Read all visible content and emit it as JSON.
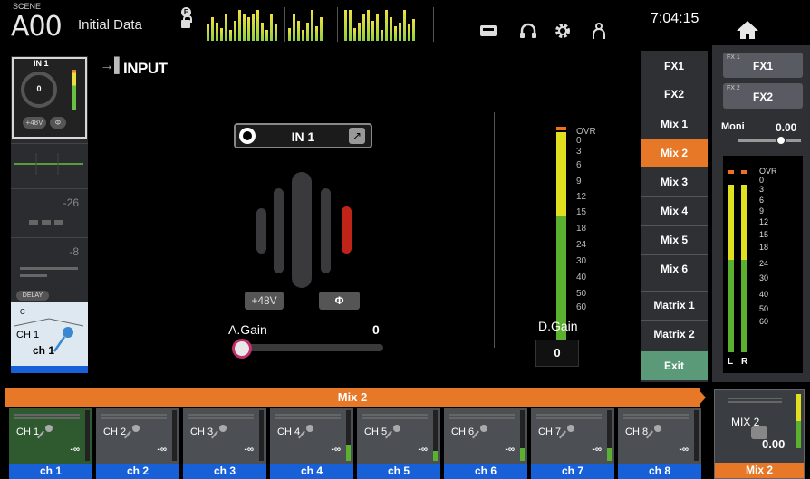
{
  "scene": {
    "label": "SCENE",
    "number": "A00",
    "title": "Initial Data"
  },
  "lock_badge": "E",
  "clock": "7:04:15",
  "colors": {
    "accent": "#e67828",
    "channel_blue": "#1860d8",
    "exit_green": "#5a9a78"
  },
  "strip": {
    "input_label": "IN 1",
    "gain_value": "0",
    "phantom_label": "+48V",
    "phase_label": "Φ",
    "gate_value": "-26",
    "comp_value": "-8",
    "delay_label": "DELAY",
    "pan_label": "C",
    "channel_id": "CH 1",
    "channel_name": "ch 1"
  },
  "input_panel": {
    "title": "INPUT",
    "port_name": "IN 1",
    "phantom_label": "+48V",
    "phase_label": "Φ",
    "again_label": "A.Gain",
    "again_value": "0",
    "dgain_label": "D.Gain",
    "dgain_value": "0",
    "meter_scale": [
      "OVR",
      "0",
      "3",
      "6",
      "9",
      "12",
      "15",
      "18",
      "24",
      "30",
      "40",
      "50",
      "60"
    ]
  },
  "bus_buttons": [
    "FX1",
    "FX2",
    "Mix 1",
    "Mix 2",
    "Mix 3",
    "Mix 4",
    "Mix 5",
    "Mix 6",
    "Matrix 1",
    "Matrix 2"
  ],
  "active_bus": "Mix 2",
  "exit_label": "Exit",
  "right_panel": {
    "fx1_small": "FX 1",
    "fx1": "FX1",
    "fx2_small": "FX 2",
    "fx2": "FX2",
    "moni_label": "Moni",
    "moni_value": "0.00",
    "meter_scale": [
      "OVR",
      "0",
      "3",
      "6",
      "9",
      "12",
      "15",
      "18",
      "24",
      "30",
      "40",
      "50",
      "60"
    ],
    "left_label": "L",
    "right_label": "R"
  },
  "send_bar": {
    "title": "Mix 2"
  },
  "channels": [
    {
      "id": "CH 1",
      "name": "ch 1",
      "level": "-∞",
      "meter": 0.0
    },
    {
      "id": "CH 2",
      "name": "ch 2",
      "level": "-∞",
      "meter": 0.0
    },
    {
      "id": "CH 3",
      "name": "ch 3",
      "level": "-∞",
      "meter": 0.0
    },
    {
      "id": "CH 4",
      "name": "ch 4",
      "level": "-∞",
      "meter": 0.3
    },
    {
      "id": "CH 5",
      "name": "ch 5",
      "level": "-∞",
      "meter": 0.2
    },
    {
      "id": "CH 6",
      "name": "ch 6",
      "level": "-∞",
      "meter": 0.25
    },
    {
      "id": "CH 7",
      "name": "ch 7",
      "level": "-∞",
      "meter": 0.25
    },
    {
      "id": "CH 8",
      "name": "ch 8",
      "level": "-∞",
      "meter": 0.0
    }
  ],
  "mix_master": {
    "label": "MIX 2",
    "value": "0.00",
    "name": "Mix 2"
  }
}
